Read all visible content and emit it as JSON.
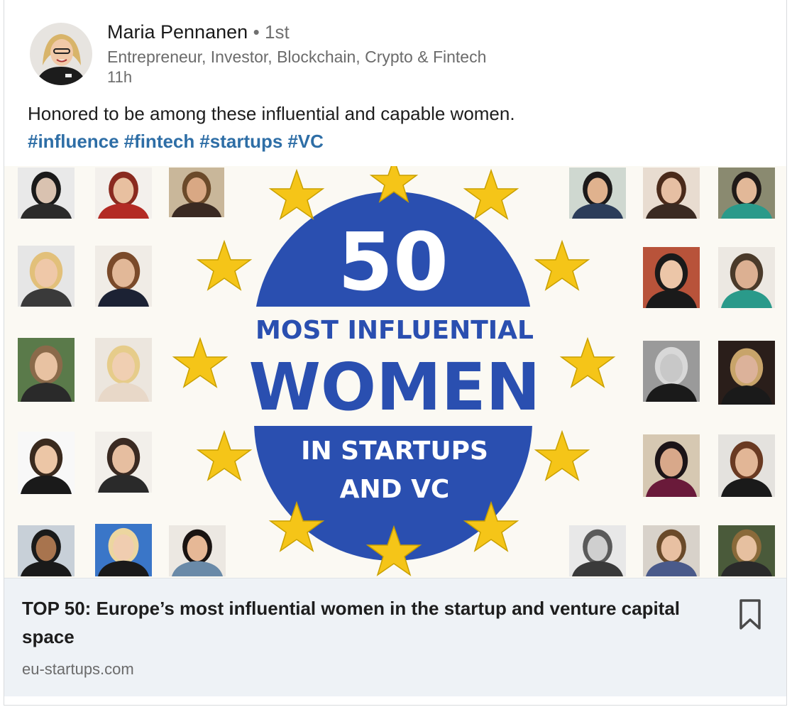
{
  "author": {
    "name": "Maria Pennanen",
    "degree": "• 1st",
    "headline": "Entrepreneur, Investor, Blockchain, Crypto & Fintech",
    "time": "11h"
  },
  "post": {
    "text": "Honored to be among these influential and capable women.",
    "hashtags": [
      "#influence",
      "#fintech",
      "#startups",
      "#VC"
    ]
  },
  "image": {
    "number": "50",
    "line1": "MOST INFLUENTIAL",
    "line2": "WOMEN",
    "line3": "IN STARTUPS",
    "line4": "AND VC",
    "colors": {
      "blue": "#2a4fb0",
      "star": "#f5c518",
      "background": "#fbf9f3"
    }
  },
  "article": {
    "title": "TOP 50: Europe’s most influential women in the startup and venture capital space",
    "source": "eu-startups.com",
    "bookmark_icon": "bookmark-icon"
  }
}
